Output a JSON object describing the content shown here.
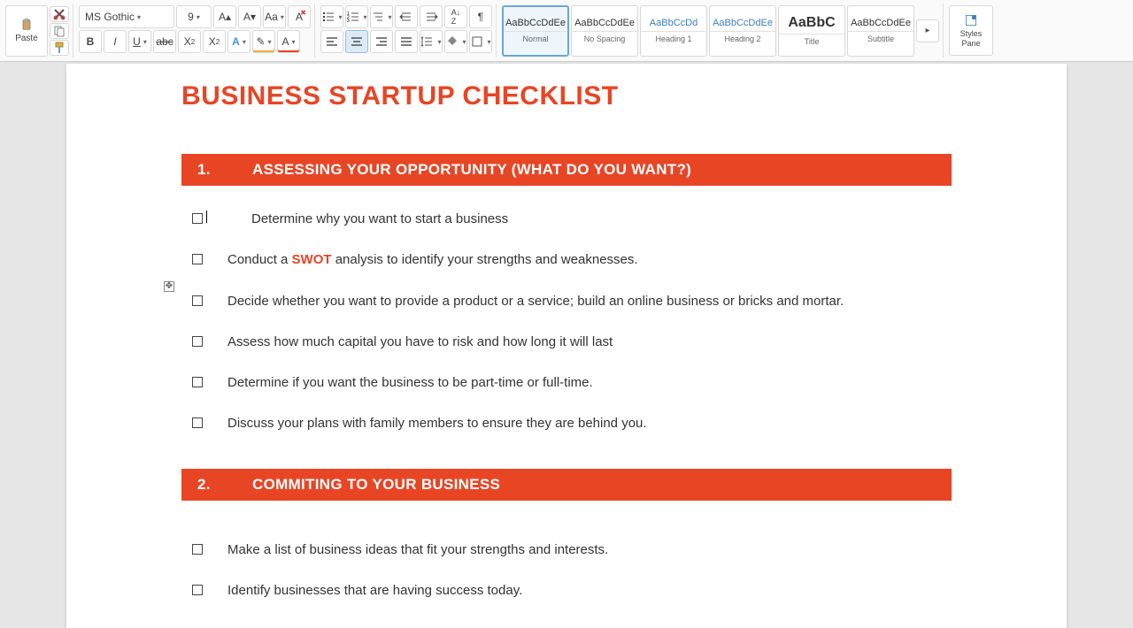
{
  "ribbon": {
    "paste_label": "Paste",
    "font_name": "MS Gothic",
    "font_size": "9",
    "styles": [
      {
        "preview": "AaBbCcDdEe",
        "name": "Normal",
        "selected": true,
        "cls": "black"
      },
      {
        "preview": "AaBbCcDdEe",
        "name": "No Spacing",
        "selected": false,
        "cls": "black"
      },
      {
        "preview": "AaBbCcDd",
        "name": "Heading 1",
        "selected": false,
        "cls": ""
      },
      {
        "preview": "AaBbCcDdEe",
        "name": "Heading 2",
        "selected": false,
        "cls": ""
      },
      {
        "preview": "AaBbC",
        "name": "Title",
        "selected": false,
        "cls": "title black"
      },
      {
        "preview": "AaBbCcDdEe",
        "name": "Subtitle",
        "selected": false,
        "cls": "black"
      }
    ],
    "styles_pane": "Styles Pane"
  },
  "document": {
    "title": "BUSINESS STARTUP CHECKLIST",
    "sections": [
      {
        "num": "1.",
        "heading": "ASSESSING YOUR OPPORTUNITY (WHAT DO YOU WANT?)",
        "items": [
          {
            "text": "Determine why you want to start a business",
            "has_cursor": true
          },
          {
            "pre": "Conduct a ",
            "swot": "SWOT",
            "post": " analysis to identify your strengths and weaknesses."
          },
          {
            "text": "Decide whether you want to provide a product or a service; build an online business or bricks and mortar."
          },
          {
            "text": "Assess how much capital you have to risk and how long it will last"
          },
          {
            "text": "Determine if you want the business to be part-time or full-time."
          },
          {
            "text": "Discuss your plans with family members to ensure they are behind you."
          }
        ]
      },
      {
        "num": "2.",
        "heading": "COMMITING TO YOUR BUSINESS",
        "items": [
          {
            "text": "Make a list of business ideas that fit your strengths and interests."
          },
          {
            "text": "Identify businesses that are having success today."
          }
        ]
      }
    ]
  }
}
